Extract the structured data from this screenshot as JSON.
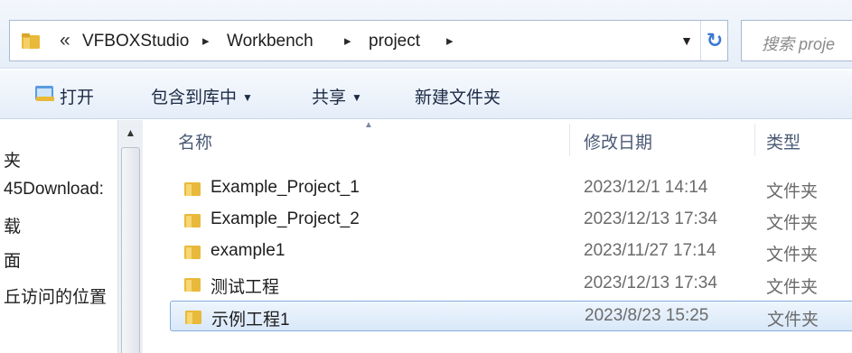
{
  "address_bar": {
    "overflow_chevrons": "«",
    "breadcrumbs": [
      "VFBOXStudio",
      "Workbench",
      "project"
    ],
    "separator": "▸",
    "dropdown": "▼",
    "refresh": "↻"
  },
  "search": {
    "placeholder": "搜索 proje"
  },
  "toolbar": {
    "open_label": "打开",
    "include_library_label": "包含到库中",
    "share_label": "共享",
    "new_folder_label": "新建文件夹",
    "dropdown_arrow": "▼"
  },
  "nav_pane": {
    "items": [
      "夹",
      "45Download:",
      "载",
      "面",
      "丘访问的位置"
    ],
    "scroll_up": "▲"
  },
  "columns": {
    "name": "名称",
    "date": "修改日期",
    "type": "类型",
    "sort_indicator": "▲"
  },
  "files": [
    {
      "name": "Example_Project_1",
      "date": "2023/12/1 14:14",
      "type": "文件夹",
      "selected": false
    },
    {
      "name": "Example_Project_2",
      "date": "2023/12/13 17:34",
      "type": "文件夹",
      "selected": false
    },
    {
      "name": "example1",
      "date": "2023/11/27 17:14",
      "type": "文件夹",
      "selected": false
    },
    {
      "name": "测试工程",
      "date": "2023/12/13 17:34",
      "type": "文件夹",
      "selected": false
    },
    {
      "name": "示例工程1",
      "date": "2023/8/23 15:25",
      "type": "文件夹",
      "selected": true
    }
  ],
  "colors": {
    "folder": "#e8b93a",
    "selection_border": "#84aee0",
    "accent": "#3b78d4"
  }
}
